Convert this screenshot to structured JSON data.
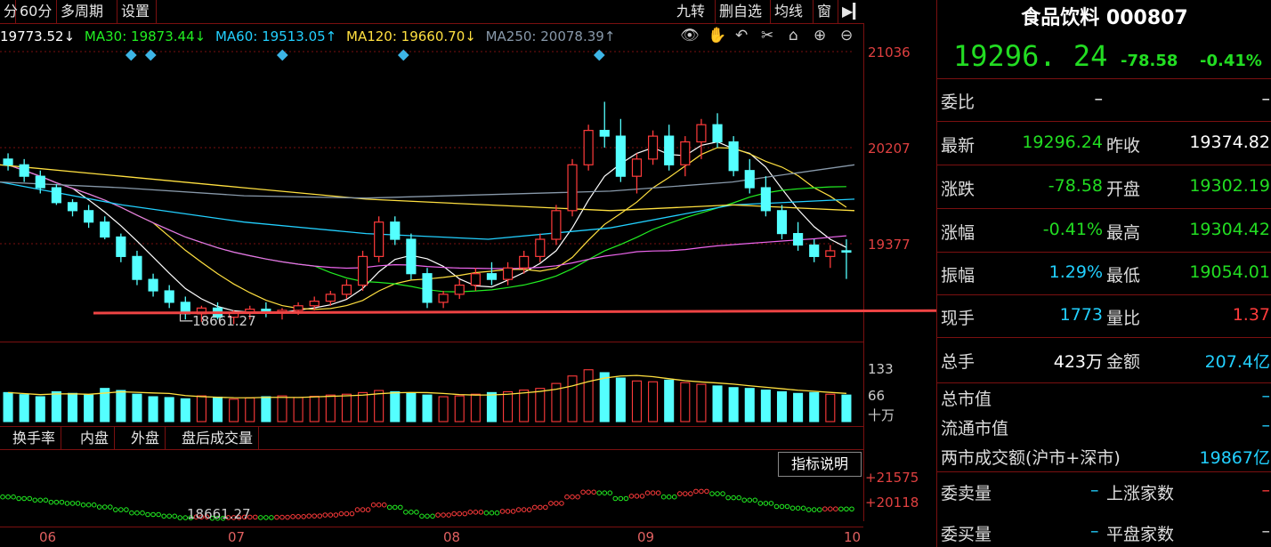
{
  "toolbar": {
    "tabs": [
      "分",
      "60分",
      "多周期",
      "设置"
    ],
    "right_tabs": [
      "九转",
      "删自选",
      "均线",
      "窗"
    ]
  },
  "ma_legend": [
    {
      "text": "19773.52↓",
      "color": "#ffffff"
    },
    {
      "text": "MA30: 19873.44↓",
      "color": "#22ee22"
    },
    {
      "text": "MA60: 19513.05↑",
      "color": "#22d0ff"
    },
    {
      "text": "MA120: 19660.70↓",
      "color": "#ffe040"
    },
    {
      "text": "MA250: 20078.39↑",
      "color": "#8899aa"
    }
  ],
  "price_axis": [
    "21036",
    "20207",
    "19377"
  ],
  "low_marker": "18661.27",
  "volume_axis": [
    "133",
    "66",
    "十万"
  ],
  "sub_tabs": [
    "换手率",
    "内盘",
    "外盘",
    "盘后成交量"
  ],
  "indicator_button": "指标说明",
  "sub_axis": [
    "+21575",
    "+20118"
  ],
  "sub_low_marker": "18661.27",
  "months": [
    "06",
    "07",
    "08",
    "09",
    "10"
  ],
  "chart_data": {
    "type": "candlestick",
    "title": "",
    "ylim": [
      18500,
      21100
    ],
    "candles": [
      [
        20100,
        20150,
        20000,
        20050
      ],
      [
        20050,
        20100,
        19900,
        19950
      ],
      [
        19950,
        20000,
        19800,
        19850
      ],
      [
        19850,
        19880,
        19700,
        19720
      ],
      [
        19720,
        19750,
        19600,
        19650
      ],
      [
        19650,
        19700,
        19500,
        19550
      ],
      [
        19550,
        19600,
        19400,
        19420
      ],
      [
        19420,
        19450,
        19200,
        19250
      ],
      [
        19250,
        19300,
        19000,
        19050
      ],
      [
        19050,
        19100,
        18900,
        18950
      ],
      [
        18950,
        19000,
        18800,
        18850
      ],
      [
        18850,
        18900,
        18700,
        18750
      ],
      [
        18750,
        18820,
        18680,
        18800
      ],
      [
        18800,
        18850,
        18700,
        18720
      ],
      [
        18720,
        18780,
        18661,
        18760
      ],
      [
        18760,
        18820,
        18700,
        18790
      ],
      [
        18790,
        18850,
        18720,
        18760
      ],
      [
        18760,
        18800,
        18700,
        18780
      ],
      [
        18780,
        18850,
        18740,
        18820
      ],
      [
        18820,
        18900,
        18780,
        18860
      ],
      [
        18860,
        18950,
        18820,
        18920
      ],
      [
        18920,
        19050,
        18880,
        19000
      ],
      [
        19000,
        19300,
        18950,
        19250
      ],
      [
        19250,
        19600,
        19200,
        19550
      ],
      [
        19550,
        19600,
        19350,
        19400
      ],
      [
        19400,
        19450,
        19050,
        19100
      ],
      [
        19100,
        19150,
        18800,
        18850
      ],
      [
        18850,
        18950,
        18800,
        18920
      ],
      [
        18920,
        19050,
        18880,
        19000
      ],
      [
        19000,
        19150,
        18950,
        19100
      ],
      [
        19100,
        19200,
        19000,
        19050
      ],
      [
        19050,
        19200,
        19000,
        19150
      ],
      [
        19150,
        19300,
        19100,
        19250
      ],
      [
        19250,
        19450,
        19200,
        19400
      ],
      [
        19400,
        19700,
        19350,
        19650
      ],
      [
        19650,
        20100,
        19600,
        20050
      ],
      [
        20050,
        20400,
        20000,
        20350
      ],
      [
        20350,
        20600,
        20200,
        20300
      ],
      [
        20300,
        20450,
        19900,
        19950
      ],
      [
        19950,
        20150,
        19800,
        20100
      ],
      [
        20100,
        20350,
        20050,
        20300
      ],
      [
        20300,
        20400,
        20000,
        20050
      ],
      [
        20050,
        20300,
        19950,
        20250
      ],
      [
        20250,
        20450,
        20100,
        20400
      ],
      [
        20400,
        20500,
        20200,
        20250
      ],
      [
        20250,
        20300,
        19950,
        20000
      ],
      [
        20000,
        20100,
        19800,
        19850
      ],
      [
        19850,
        19950,
        19600,
        19650
      ],
      [
        19650,
        19700,
        19400,
        19450
      ],
      [
        19450,
        19550,
        19300,
        19350
      ],
      [
        19350,
        19400,
        19200,
        19250
      ],
      [
        19250,
        19350,
        19150,
        19300
      ],
      [
        19300,
        19400,
        19054,
        19296
      ]
    ],
    "volume_max": 133,
    "volumes": [
      70,
      65,
      60,
      72,
      68,
      64,
      80,
      75,
      66,
      60,
      58,
      55,
      62,
      59,
      54,
      57,
      60,
      62,
      58,
      61,
      64,
      66,
      70,
      75,
      72,
      68,
      64,
      60,
      62,
      66,
      70,
      72,
      76,
      80,
      92,
      110,
      125,
      118,
      105,
      98,
      96,
      100,
      94,
      90,
      86,
      82,
      80,
      76,
      72,
      68,
      70,
      66,
      64
    ],
    "ma_series": [
      {
        "name": "MA30",
        "color": "#22ee22"
      },
      {
        "name": "MA60",
        "color": "#22d0ff"
      },
      {
        "name": "MA120",
        "color": "#ffe040"
      },
      {
        "name": "MA250",
        "color": "#8899aa"
      }
    ]
  },
  "panel": {
    "title": "食品饮料 000807",
    "price": "19296. 24",
    "change": "-78.58",
    "change_pct": "-0.41%",
    "rows": [
      {
        "l1": "委比",
        "v1": "–",
        "v1c": "white",
        "l2": "",
        "v2": "–",
        "v2c": "white"
      },
      {
        "l1": "最新",
        "v1": "19296.24",
        "v1c": "green",
        "l2": "昨收",
        "v2": "19374.82",
        "v2c": "white"
      },
      {
        "l1": "涨跌",
        "v1": "-78.58",
        "v1c": "green",
        "l2": "开盘",
        "v2": "19302.19",
        "v2c": "green"
      },
      {
        "l1": "涨幅",
        "v1": "-0.41%",
        "v1c": "green",
        "l2": "最高",
        "v2": "19304.42",
        "v2c": "green"
      },
      {
        "l1": "振幅",
        "v1": "1.29%",
        "v1c": "cyan",
        "l2": "最低",
        "v2": "19054.01",
        "v2c": "green"
      },
      {
        "l1": "现手",
        "v1": "1773",
        "v1c": "cyan",
        "l2": "量比",
        "v2": "1.37",
        "v2c": "red"
      },
      {
        "l1": "总手",
        "v1": "423万",
        "v1c": "white",
        "l2": "金额",
        "v2": "207.4亿",
        "v2c": "cyan"
      }
    ],
    "market_cap_label": "总市值",
    "market_cap_value": "–",
    "float_cap_label": "流通市值",
    "float_cap_value": "–",
    "turnover_label": "两市成交额(沪市+深市)",
    "turnover_value": "19867亿",
    "sell_qty_label": "委卖量",
    "sell_qty_value": "–",
    "buy_qty_label": "委买量",
    "buy_qty_value": "–",
    "up_count_label": "上涨家数",
    "up_count_value": "–",
    "flat_count_label": "平盘家数",
    "flat_count_value": "–"
  }
}
